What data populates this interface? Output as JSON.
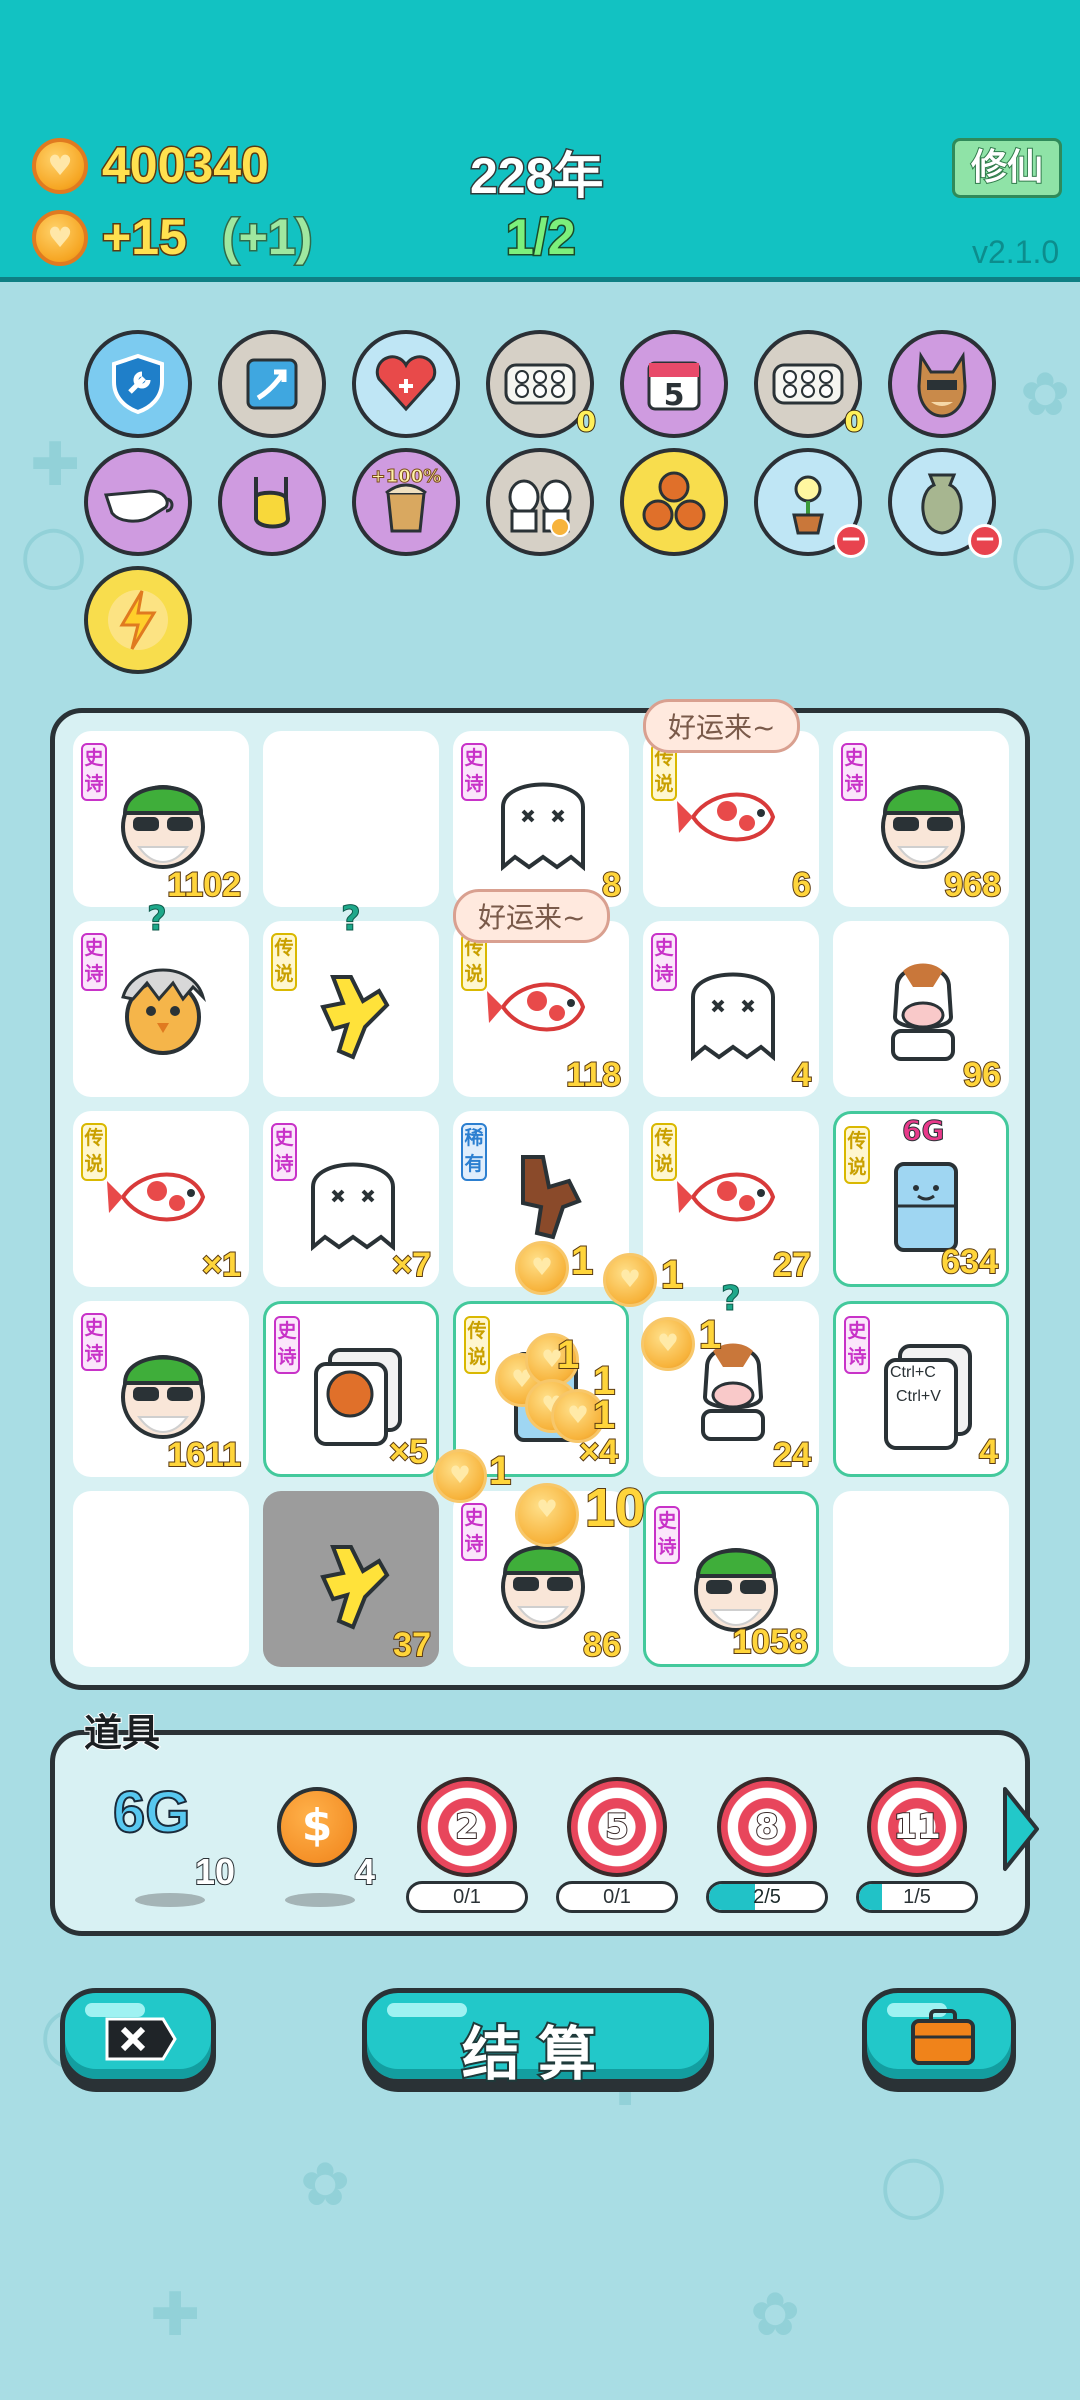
{
  "header": {
    "coins": "400340",
    "income": "+15",
    "income_bonus": "(+1)",
    "year": "228年",
    "progress": "1/2",
    "cultivate_label": "修仙",
    "version": "v2.1.0"
  },
  "skills": {
    "row1": [
      {
        "icon": "wrench-shield-icon",
        "badge": ""
      },
      {
        "icon": "upgrade-arrow-icon",
        "badge": ""
      },
      {
        "icon": "heart-plus-icon",
        "badge": ""
      },
      {
        "icon": "egg-tray-icon",
        "badge": "0"
      },
      {
        "icon": "calendar-icon",
        "badge": "",
        "text": "5"
      },
      {
        "icon": "egg-tray-icon",
        "badge": "0"
      },
      {
        "icon": "shiba-dog-icon",
        "badge": ""
      }
    ],
    "row2": [
      {
        "icon": "gravy-boat-icon",
        "badge": ""
      },
      {
        "icon": "rock-hand-icon",
        "badge": ""
      },
      {
        "icon": "bubble-tea-icon",
        "badge": "",
        "text": "+100%"
      },
      {
        "icon": "twin-cows-icon",
        "badge": ""
      },
      {
        "icon": "basketballs-icon",
        "badge": ""
      },
      {
        "icon": "potted-flower-icon",
        "badge": ""
      },
      {
        "icon": "trash-bag-icon",
        "badge": ""
      }
    ],
    "row3": [
      {
        "icon": "lightning-icon",
        "badge": ""
      }
    ]
  },
  "board": {
    "epic_tag": "史诗",
    "legend_tag": "传说",
    "rare_tag": "稀有",
    "lucky_text": "好运来~",
    "cells": [
      {
        "count": "1102"
      },
      {
        "count": ""
      },
      {
        "count": "8"
      },
      {
        "count": "6"
      },
      {
        "count": "968"
      },
      {
        "count": ""
      },
      {
        "count": ""
      },
      {
        "count": "118"
      },
      {
        "count": "4"
      },
      {
        "count": "96"
      },
      {
        "count": "×1"
      },
      {
        "count": "×7"
      },
      {
        "count": ""
      },
      {
        "count": "27"
      },
      {
        "count": "634",
        "label": "6G"
      },
      {
        "count": "1611"
      },
      {
        "count": "×5"
      },
      {
        "count": "×4"
      },
      {
        "count": "24"
      },
      {
        "count": "4",
        "text1": "Ctrl+C",
        "text2": "Ctrl+V"
      },
      {
        "count": ""
      },
      {
        "count": "37"
      },
      {
        "count": "86"
      },
      {
        "count": "1058"
      },
      {
        "count": ""
      }
    ],
    "floating": [
      "1",
      "1",
      "1",
      "1",
      "1",
      "1",
      "1",
      "10"
    ]
  },
  "items": {
    "title": "道具",
    "entries": [
      {
        "name": "6G",
        "count": "10"
      },
      {
        "name": "dollar-coin",
        "count": "4"
      },
      {
        "target": "2",
        "progress": "0/1",
        "fill": 0
      },
      {
        "target": "5",
        "progress": "0/1",
        "fill": 0
      },
      {
        "target": "8",
        "progress": "2/5",
        "fill": 0.4
      },
      {
        "target": "11",
        "progress": "1/5",
        "fill": 0.2
      }
    ]
  },
  "buttons": {
    "settle": "结算"
  },
  "colors": {
    "header_bg": "#12c2c2",
    "page_bg": "#a9dde4",
    "gold": "#ffd53b",
    "accent": "#22c8c9"
  }
}
